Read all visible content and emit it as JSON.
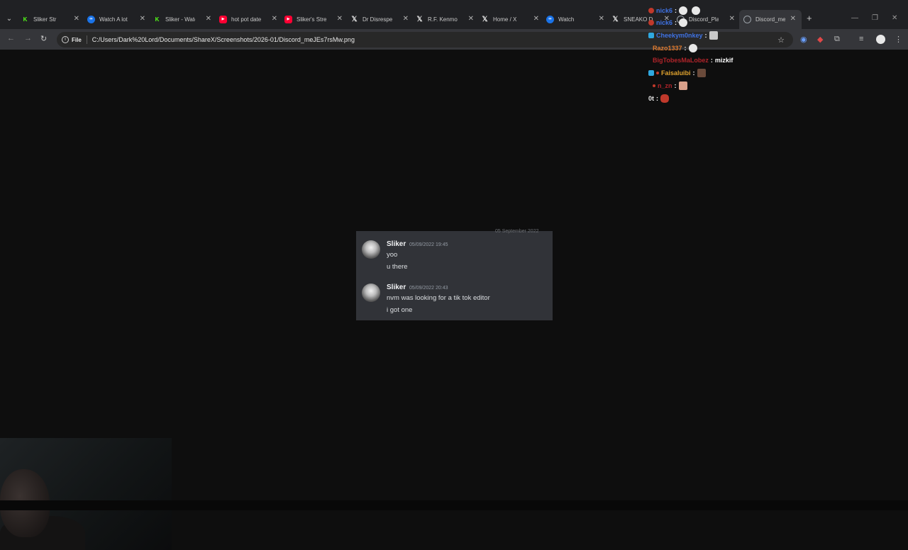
{
  "browser": {
    "tabs": [
      {
        "label": "Sliker Str",
        "icon": "kick-icon",
        "color": "#53fc18"
      },
      {
        "label": "Watch A lot",
        "icon": "globe-icon",
        "color": "#1a73e8"
      },
      {
        "label": "Sliker - Watc",
        "icon": "kick-icon",
        "color": "#53fc18"
      },
      {
        "label": "hot pot date",
        "icon": "youtube-icon",
        "color": "#ff0033"
      },
      {
        "label": "Sliker's Strea",
        "icon": "youtube-icon",
        "color": "#ff0033"
      },
      {
        "label": "Dr Disrespec",
        "icon": "x-icon",
        "color": "#e8e8e8"
      },
      {
        "label": "R.F. Kenmon",
        "icon": "x-icon",
        "color": "#e8e8e8"
      },
      {
        "label": "Home / X",
        "icon": "x-icon",
        "color": "#e8e8e8"
      },
      {
        "label": "Watch",
        "icon": "globe-icon",
        "color": "#1a73e8"
      },
      {
        "label": "SNEAKO DA",
        "icon": "x-icon",
        "color": "#e8e8e8"
      },
      {
        "label": "Discord_Play",
        "icon": "globe-icon",
        "color": "#9aa0a6"
      },
      {
        "label": "Discord_me",
        "icon": "globe-icon",
        "color": "#9aa0a6",
        "active": true
      }
    ],
    "address": {
      "scheme": "File",
      "url": "C:/Users/Dark%20Lord/Documents/ShareX/Screenshots/2026-01/Discord_meJEs7rsMw.png"
    }
  },
  "chat_overlay": [
    {
      "user": "nick6",
      "color": "#3f72e3",
      "message": ""
    },
    {
      "user": "nick6",
      "color": "#3f72e3",
      "message": ""
    },
    {
      "user": "Cheekym0nkey",
      "color": "#3f72e3",
      "message": ""
    },
    {
      "user": "Razo1337",
      "color": "#e07b2e",
      "message": ""
    },
    {
      "user": "BigTobesMaLobez",
      "color": "#b0242a",
      "message": "mizkif"
    },
    {
      "user": "Faisaluibi",
      "color": "#e0a32e",
      "message": ""
    },
    {
      "user": "n_zn",
      "color": "#b0242a",
      "message": ""
    },
    {
      "user": "0t",
      "color": "#e8e8e8",
      "message": ""
    }
  ],
  "discord": {
    "header_cutoff": "05 September 2022",
    "messages": [
      {
        "author": "Sliker",
        "timestamp": "05/09/2022 19:45",
        "lines": [
          "yoo",
          "u there"
        ]
      },
      {
        "author": "Sliker",
        "timestamp": "05/09/2022 20:43",
        "lines": [
          "nvm was looking for a tik tok editor",
          "i got one"
        ]
      }
    ]
  },
  "colors": {
    "tabstrip": "#202124",
    "toolbar": "#35363a",
    "discord_bg": "#313338",
    "page_bg": "#0e0e0e"
  }
}
